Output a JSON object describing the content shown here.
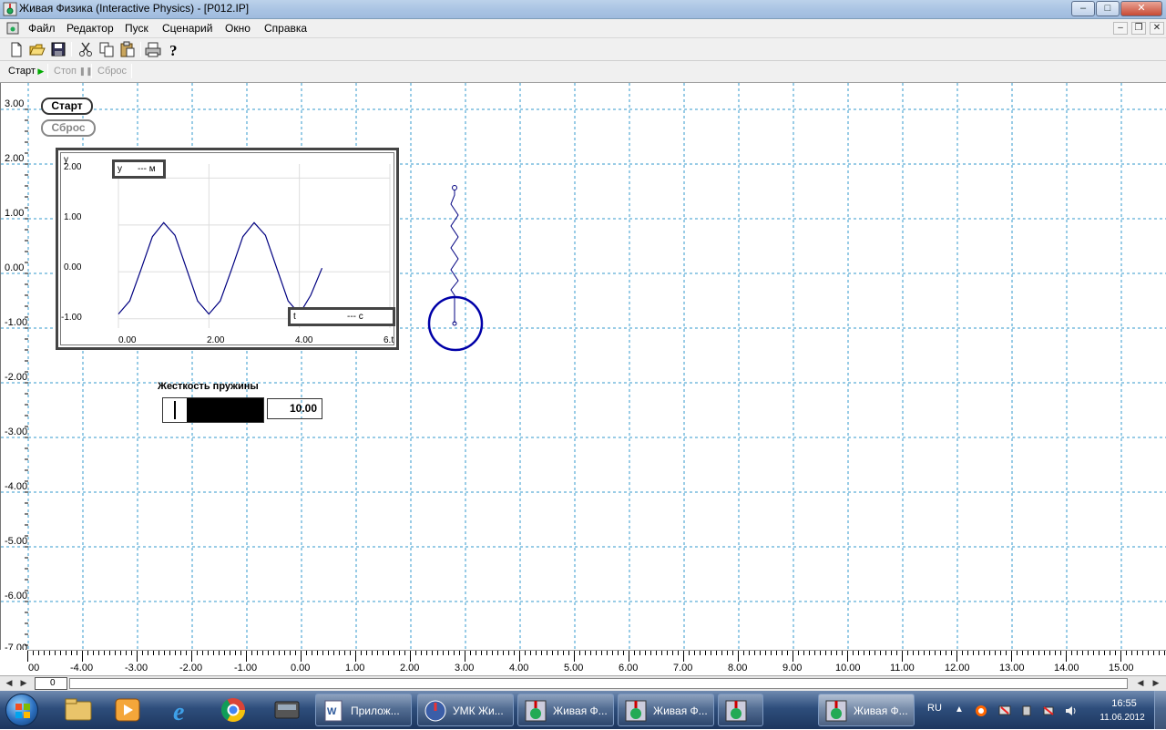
{
  "window": {
    "title": "Живая Физика (Interactive Physics) - [P012.IP]",
    "buttons": {
      "minimize": "–",
      "maximize": "□",
      "close": "✕"
    }
  },
  "menu": {
    "items": [
      "Файл",
      "Редактор",
      "Пуск",
      "Сценарий",
      "Окно",
      "Справка"
    ],
    "mdi": {
      "minimize": "–",
      "restore": "❐",
      "close": "✕"
    }
  },
  "toolbar": {
    "icons": [
      "new-icon",
      "open-icon",
      "save-icon",
      "cut-icon",
      "copy-icon",
      "paste-icon",
      "print-icon",
      "help-icon"
    ]
  },
  "runbar": {
    "start": "Старт",
    "stop": "Стоп",
    "reset": "Сброс"
  },
  "workspace": {
    "y_axis_labels": [
      "3.00",
      "2.00",
      "1.00",
      "0.00",
      "-1.00",
      "-2.00",
      "-3.00",
      "-4.00",
      "-5.00",
      "-6.00"
    ],
    "y_axis_bottom": "-7.00",
    "buttons": {
      "start": "Старт",
      "reset": "Сброс"
    },
    "graph": {
      "y_box_name": "y",
      "y_box_value": "--- м",
      "x_box_name": "t",
      "x_box_value": "--- с"
    },
    "slider": {
      "label": "Жесткость пружины",
      "value": "10.00",
      "fill_fraction": 0.76
    }
  },
  "chart_data": {
    "type": "line",
    "title": "",
    "xlabel": "t",
    "ylabel": "y",
    "xlim": [
      0,
      6
    ],
    "ylim": [
      -1.2,
      2.3
    ],
    "x_ticks": [
      "0.00",
      "2.00",
      "4.00",
      "6.t"
    ],
    "y_ticks": [
      "2.00",
      "1.00",
      "0.00",
      "-1.00"
    ],
    "series": [
      {
        "color": "#000080",
        "x": [
          0.0,
          0.25,
          0.5,
          0.75,
          1.0,
          1.25,
          1.5,
          1.75,
          2.0,
          2.25,
          2.5,
          2.75,
          3.0,
          3.25,
          3.5,
          3.75,
          4.0,
          4.25,
          4.5
        ],
        "y": [
          -0.9,
          -0.62,
          0.05,
          0.75,
          1.05,
          0.78,
          0.08,
          -0.62,
          -0.9,
          -0.62,
          0.05,
          0.75,
          1.05,
          0.78,
          0.08,
          -0.62,
          -0.9,
          -0.5,
          0.08
        ]
      }
    ]
  },
  "ruler": {
    "x_labels": [
      "00",
      "-4.00",
      "-3.00",
      "-2.00",
      "-1.00",
      "0.00",
      "1.00",
      "2.00",
      "3.00",
      "4.00",
      "5.00",
      "6.00",
      "7.00",
      "8.00",
      "9.00",
      "10.00",
      "11.00",
      "12.00",
      "13.00",
      "14.00",
      "15.00"
    ]
  },
  "hscroll": {
    "value": "0"
  },
  "taskbar": {
    "tasks": [
      "Прилож...",
      "УМК Жи...",
      "Живая Ф...",
      "Живая Ф...",
      "",
      "Живая Ф..."
    ],
    "language": "RU",
    "time": "16:55",
    "date": "11.06.2012"
  }
}
